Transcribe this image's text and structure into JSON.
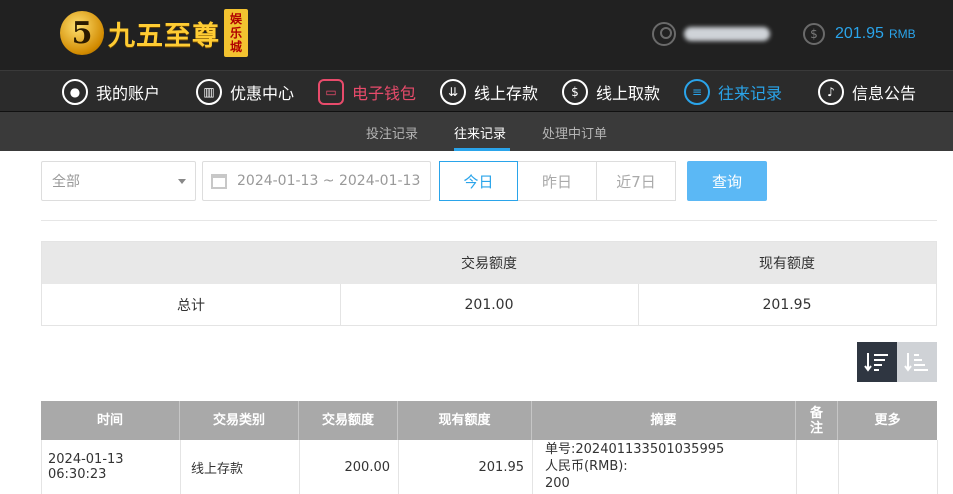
{
  "brand": {
    "badge": "5",
    "name": "九五至尊",
    "sub_chars": [
      "娱",
      "乐",
      "城"
    ]
  },
  "account": {
    "balance": "201.95",
    "currency": "RMB"
  },
  "main_nav": [
    {
      "label": "我的账户",
      "icon": "person-icon"
    },
    {
      "label": "优惠中心",
      "icon": "gift-icon"
    },
    {
      "label": "电子钱包",
      "icon": "wallet-icon"
    },
    {
      "label": "线上存款",
      "icon": "deposit-icon"
    },
    {
      "label": "线上取款",
      "icon": "withdraw-icon"
    },
    {
      "label": "往来记录",
      "icon": "records-icon"
    },
    {
      "label": "信息公告",
      "icon": "bell-icon"
    }
  ],
  "sub_nav": [
    {
      "label": "投注记录"
    },
    {
      "label": "往来记录"
    },
    {
      "label": "处理中订单"
    }
  ],
  "filters": {
    "type_selected": "全部",
    "date_range": "2024-01-13 ~ 2024-01-13",
    "quick": [
      "今日",
      "昨日",
      "近7日"
    ],
    "query_label": "查询"
  },
  "summary": {
    "headers": [
      "交易额度",
      "现有额度"
    ],
    "row_label": "总计",
    "trade_amount": "201.00",
    "current_amount": "201.95"
  },
  "records": {
    "headers": [
      "时间",
      "交易类别",
      "交易额度",
      "现有额度",
      "摘要",
      "备注",
      "更多"
    ],
    "rows": [
      {
        "time": "2024-01-13 06:30:23",
        "category": "线上存款",
        "amount": "200.00",
        "balance": "201.95",
        "memo_lines": [
          "单号:202401133501035995",
          "人民币(RMB):",
          "200"
        ],
        "note": "",
        "more": ""
      }
    ]
  },
  "colors": {
    "accent": "#2aa4ea",
    "wallet": "#e84b6b",
    "header_bg": "#212121",
    "table_head": "#a9a9a9"
  }
}
